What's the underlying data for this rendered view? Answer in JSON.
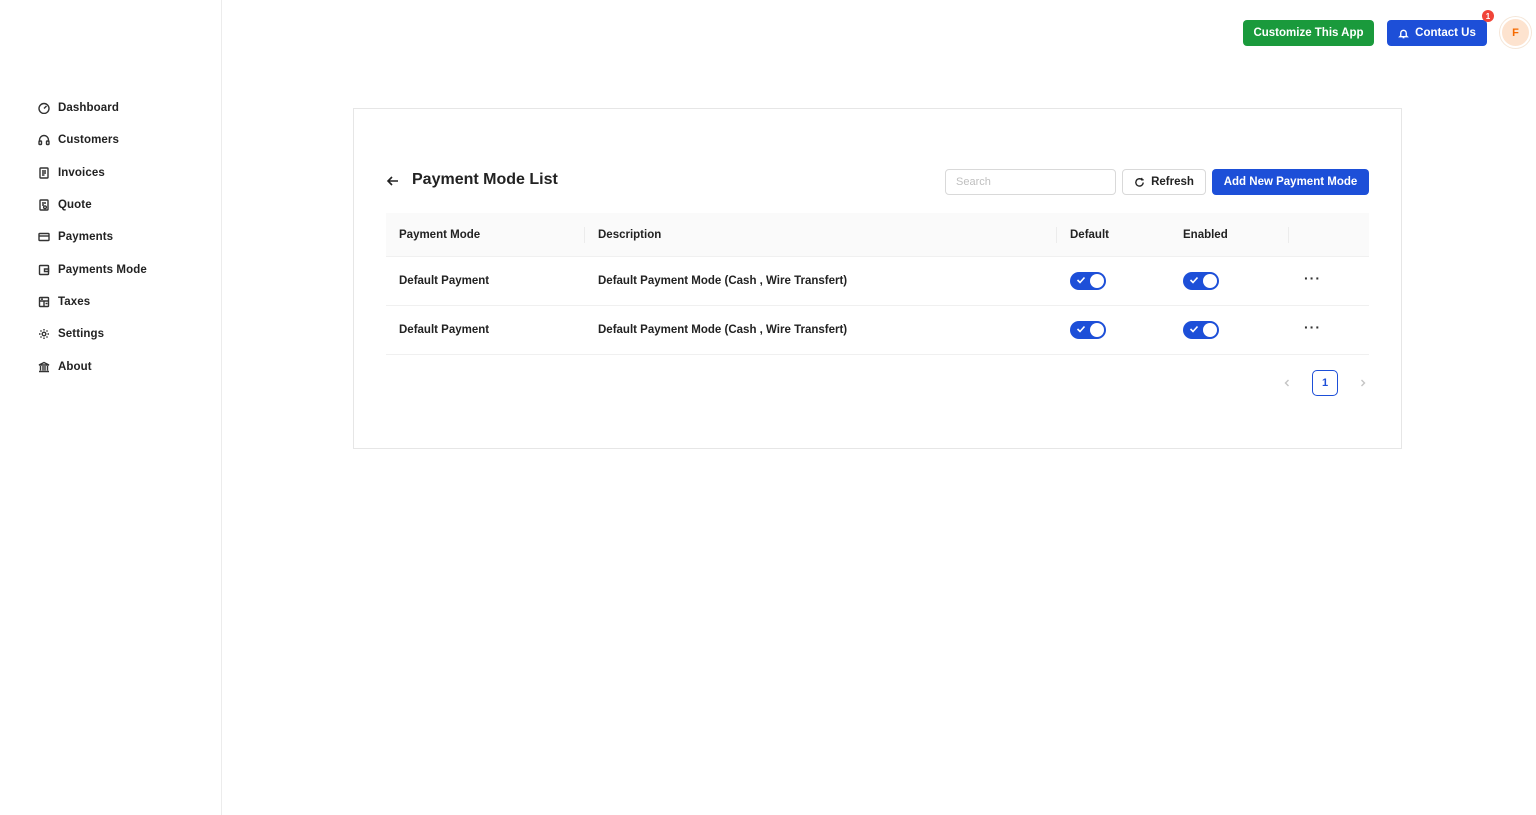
{
  "sidebar": {
    "items": [
      {
        "label": "Dashboard",
        "icon": "dashboard-icon"
      },
      {
        "label": "Customers",
        "icon": "headset-icon"
      },
      {
        "label": "Invoices",
        "icon": "file-text-icon"
      },
      {
        "label": "Quote",
        "icon": "file-sync-icon"
      },
      {
        "label": "Payments",
        "icon": "credit-card-icon"
      },
      {
        "label": "Payments Mode",
        "icon": "wallet-icon"
      },
      {
        "label": "Taxes",
        "icon": "calculator-icon"
      },
      {
        "label": "Settings",
        "icon": "gear-icon"
      },
      {
        "label": "About",
        "icon": "bank-icon"
      }
    ]
  },
  "header": {
    "customize_label": "Customize This App",
    "contact_label": "Contact Us",
    "notification_count": "1",
    "avatar_initial": "F"
  },
  "page": {
    "title": "Payment Mode List",
    "search_placeholder": "Search",
    "refresh_label": "Refresh",
    "add_label": "Add New Payment Mode"
  },
  "table": {
    "columns": [
      "Payment Mode",
      "Description",
      "Default",
      "Enabled",
      ""
    ],
    "rows": [
      {
        "payment_mode": "Default Payment",
        "description": "Default Payment Mode (Cash , Wire Transfert)",
        "default": true,
        "enabled": true,
        "actions": "···"
      },
      {
        "payment_mode": "Default Payment",
        "description": "Default Payment Mode (Cash , Wire Transfert)",
        "default": true,
        "enabled": true,
        "actions": "···"
      }
    ]
  },
  "pagination": {
    "current_page": "1"
  },
  "colors": {
    "primary": "#1d4fd8",
    "success": "#1a9a3c",
    "danger": "#f04438",
    "avatar_bg": "#fde3cf",
    "avatar_fg": "#f56a00"
  }
}
